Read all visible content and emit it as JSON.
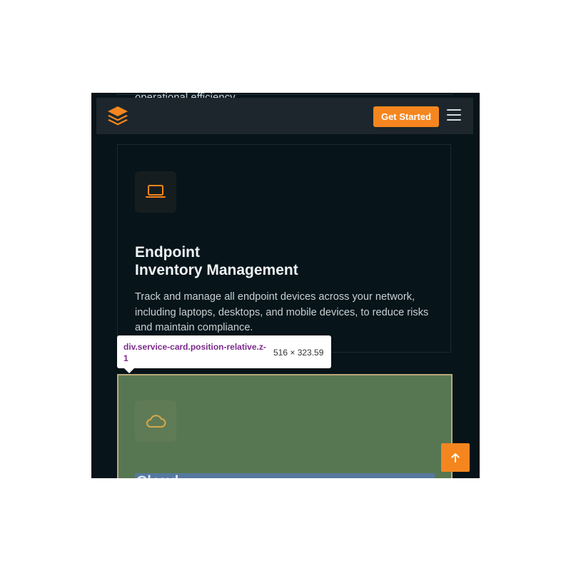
{
  "previous_card": {
    "text": "operational efficiency."
  },
  "navbar": {
    "logo_icon": "layers-logo-icon",
    "cta_label": "Get Started",
    "menu_icon": "hamburger-menu-icon"
  },
  "card1": {
    "icon": "laptop-icon",
    "title_line1": "Endpoint",
    "title_line2": "Inventory Management",
    "description": "Track and manage all endpoint devices across your network, including laptops, desktops, and mobile devices, to reduce risks and maintain compliance."
  },
  "inspector_tooltip": {
    "selector": "div.service-card.position-relative.z-1",
    "dimensions": "516 × 323.59"
  },
  "card2": {
    "icon": "cloud-icon",
    "title": "Cloud"
  },
  "scroll_top": {
    "icon": "arrow-up-icon"
  },
  "colors": {
    "accent": "#f5861f",
    "background": "#07141a",
    "navbar": "#1c262c",
    "highlight_content": "#577752",
    "highlight_text": "#5678a0"
  }
}
